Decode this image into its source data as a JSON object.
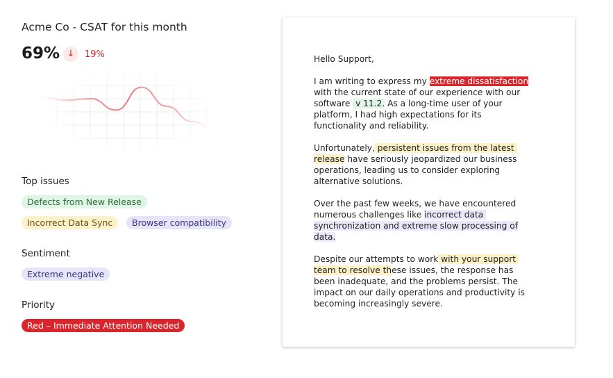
{
  "summary": {
    "title": "Acme Co - CSAT for this month",
    "score": "69%",
    "trend_icon": "arrow-down-icon",
    "delta": "19%",
    "accent": "#d9262c",
    "chart_data": {
      "type": "line",
      "values": [
        62,
        58,
        60,
        45,
        75,
        50,
        30,
        18
      ],
      "grid": true
    },
    "top_issues_label": "Top issues",
    "issues": [
      "Defects from New Release",
      "Incorrect Data Sync",
      "Browser compatibility"
    ],
    "sentiment_label": "Sentiment",
    "sentiment": "Extreme negative",
    "priority_label": "Priority",
    "priority": "Red – Immediate Attention Needed"
  },
  "letter": {
    "greeting": "Hello Support,",
    "paragraphs": [
      [
        [
          [
            "I am writing to express my ",
            ""
          ],
          [
            "extreme dissatisfaction",
            "red"
          ]
        ],
        [
          [
            "with the current state of our experience with our",
            ""
          ]
        ],
        [
          [
            "software ",
            ""
          ],
          [
            " v 11.2.",
            "green"
          ],
          [
            " As a long-time user of your",
            ""
          ]
        ],
        [
          [
            "platform, I had high expectations for its",
            ""
          ]
        ],
        [
          [
            "functionality and reliability.",
            ""
          ]
        ]
      ],
      [
        [
          [
            "Unfortunately,",
            ""
          ],
          [
            " persistent issues from the latest ",
            "yellow"
          ]
        ],
        [
          [
            "release",
            "yellow"
          ],
          [
            " have seriously jeopardized our business",
            ""
          ]
        ],
        [
          [
            "operations, leading us to consider exploring",
            ""
          ]
        ],
        [
          [
            "alternative solutions.",
            ""
          ]
        ]
      ],
      [
        [
          [
            "Over the past few weeks, we have encountered",
            ""
          ]
        ],
        [
          [
            "numerous challenges like ",
            ""
          ],
          [
            "incorrect data ",
            "purple"
          ]
        ],
        [
          [
            "synchronization and extreme slow processing of",
            "purple"
          ]
        ],
        [
          [
            "data.",
            "purple"
          ]
        ]
      ],
      [
        [
          [
            "Despite our attempts to work",
            ""
          ],
          [
            " with your support ",
            "yellow"
          ]
        ],
        [
          [
            "team to resolve th",
            "yellow"
          ],
          [
            "ese issues, the response has",
            ""
          ]
        ],
        [
          [
            "been inadequate, and the problems persist. The",
            ""
          ]
        ],
        [
          [
            "impact on our daily operations and productivity is",
            ""
          ]
        ],
        [
          [
            "becoming increasingly severe.",
            ""
          ]
        ]
      ]
    ]
  }
}
